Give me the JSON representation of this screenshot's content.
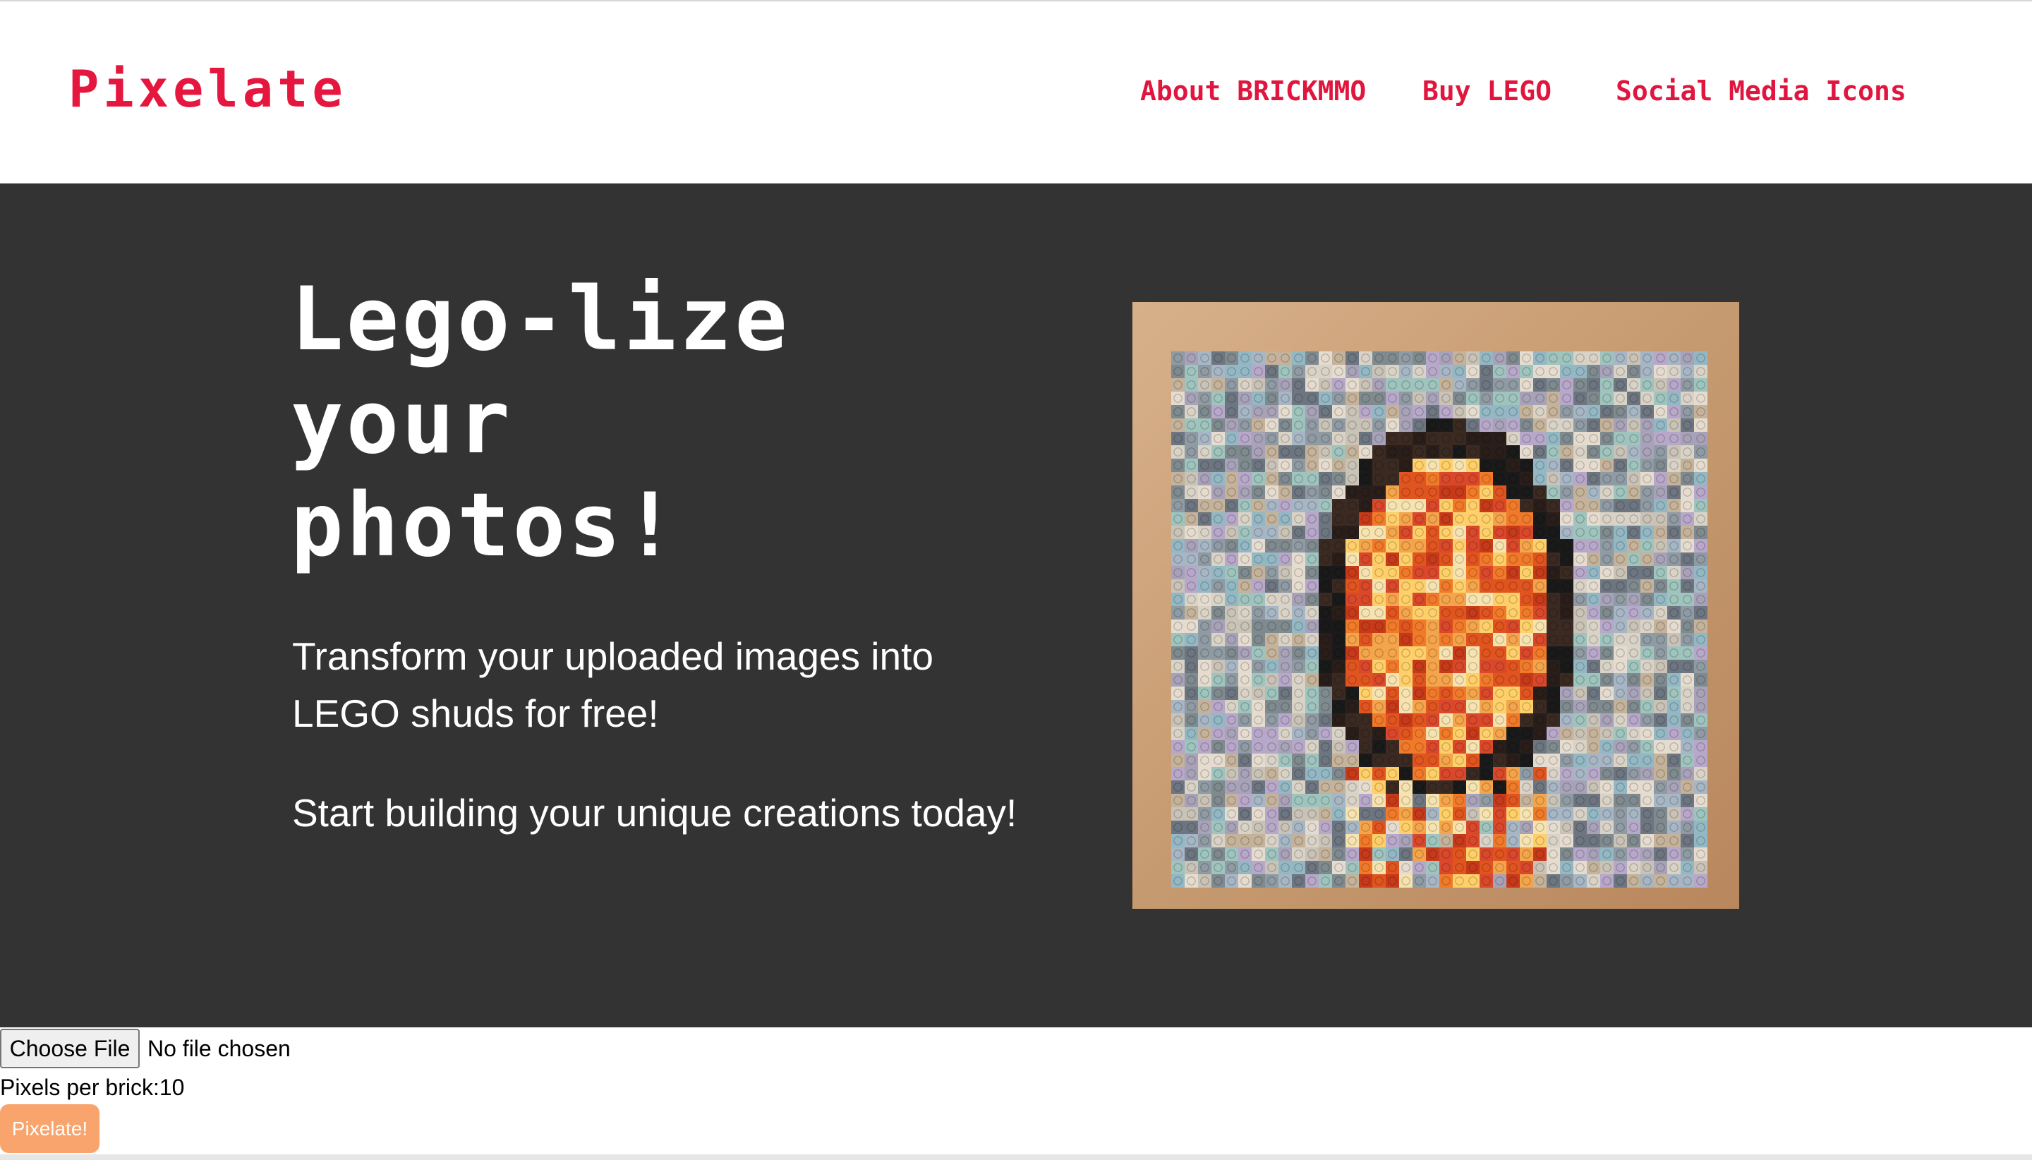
{
  "header": {
    "logo": "Pixelate",
    "nav": [
      {
        "label": "About BRICKMMO"
      },
      {
        "label": "Buy LEGO"
      },
      {
        "label": "Social Media Icons"
      }
    ]
  },
  "hero": {
    "title": "Lego-lize\nyour\nphotos!",
    "paragraph_1": "Transform your uploaded images into LEGO shuds for free!",
    "paragraph_2": "Start building your unique creations today!"
  },
  "uploader": {
    "choose_file_label": "Choose File",
    "file_status": "No file chosen",
    "pixels_per_brick_label": "Pixels per brick:",
    "pixels_per_brick_value": "10",
    "submit_label": "Pixelate!"
  },
  "colors": {
    "brand_red": "#e5173f",
    "hero_background": "#333333",
    "button_orange": "#f9a46c"
  }
}
